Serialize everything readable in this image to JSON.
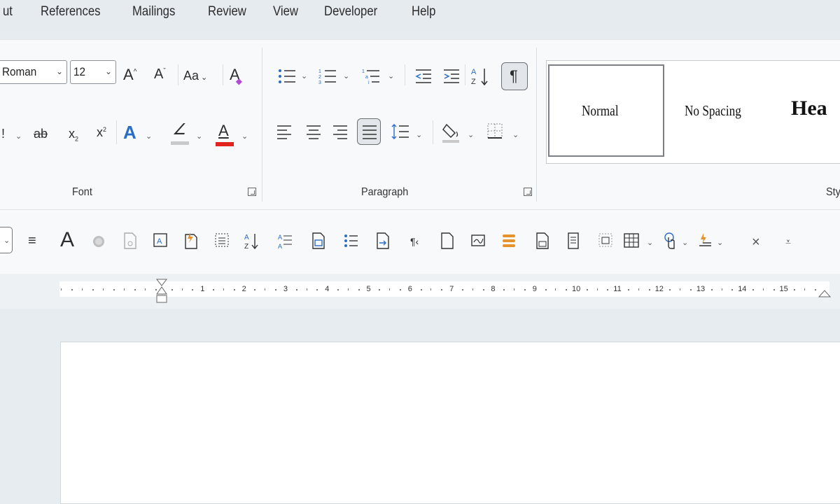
{
  "menu": [
    "ut",
    "References",
    "Mailings",
    "Review",
    "View",
    "Developer",
    "Help"
  ],
  "font": {
    "name": "Roman",
    "size": "12",
    "case_button": "Aa",
    "group_label": "Font"
  },
  "paragraph": {
    "group_label": "Paragraph",
    "show_marks_glyph": "¶"
  },
  "styles": {
    "items": [
      "Normal",
      "No Spacing",
      "Hea"
    ],
    "group_label_partial": "Sty"
  },
  "ruler": {
    "labels": [
      "1",
      "2",
      "3",
      "4",
      "5",
      "6",
      "7",
      "8",
      "9",
      "10",
      "11",
      "12",
      "13",
      "14",
      "15"
    ]
  },
  "colors": {
    "font_color_bar": "#e0231c",
    "highlight_bar": "#c9c9c9",
    "orange_icon": "#e6922a",
    "blue_icon": "#2b6cc4"
  }
}
